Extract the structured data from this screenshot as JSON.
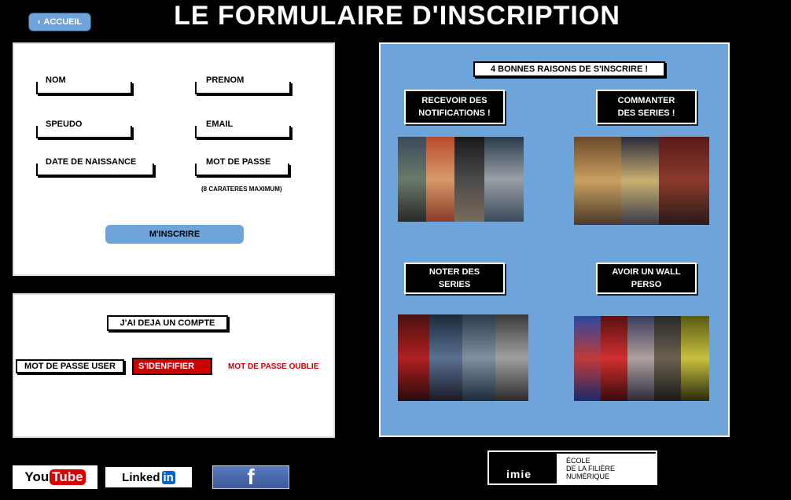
{
  "header": {
    "back_label": "ACCUEIL",
    "title": "LE FORMULAIRE D'INSCRIPTION"
  },
  "signup_form": {
    "fields": [
      {
        "label": "NOM"
      },
      {
        "label": "PRENOM"
      },
      {
        "label": "SPEUDO"
      },
      {
        "label": "EMAIL"
      },
      {
        "label": "DATE DE NAISSANCE"
      },
      {
        "label": "MOT DE PASSE"
      }
    ],
    "password_note": "(8 CARATERES MAXIMUM)",
    "submit_label": "M'INSCRIRE"
  },
  "login": {
    "heading": "J'AI DEJA UN COMPTE",
    "password_field": "MOT DE PASSE USER",
    "login_button": "S'IDENFIFIER",
    "forgot_link": "MOT DE PASSE OUBLIE"
  },
  "reasons": {
    "heading": "4 BONNES RAISONS DE S'INSCRIRE !",
    "items": [
      {
        "line1": "RECEVOIR DES",
        "line2": "NOTIFICATIONS !"
      },
      {
        "line1": "COMMANTER",
        "line2": "DES SERIES !"
      },
      {
        "line1": "NOTER DES",
        "line2": "SERIES"
      },
      {
        "line1": "AVOIR UN WALL",
        "line2": "PERSO"
      }
    ]
  },
  "footer": {
    "youtube_a": "You",
    "youtube_b": "Tube",
    "linkedin_a": "Linked",
    "linkedin_b": "in",
    "facebook": "f",
    "school_brand": "imie",
    "school_line1": "ÉCOLE",
    "school_line2": "DE LA FILIÈRE",
    "school_line3": "NUMÉRIQUE"
  },
  "colors": {
    "accent_blue": "#6fa4da",
    "login_red": "#cc0000",
    "background": "#000000"
  }
}
